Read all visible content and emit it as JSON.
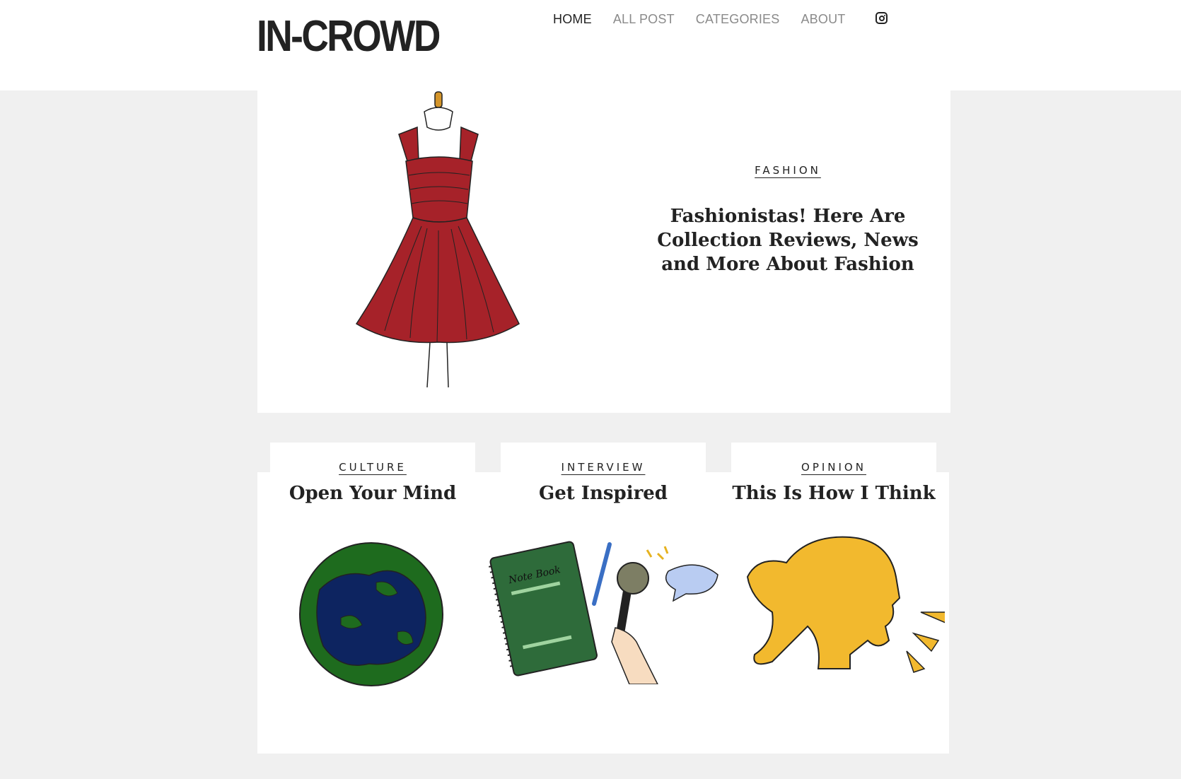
{
  "header": {
    "logo": "IN-CROWD",
    "nav": [
      {
        "label": "HOME",
        "active": true
      },
      {
        "label": "ALL POST",
        "active": false
      },
      {
        "label": "CATEGORIES",
        "active": false
      },
      {
        "label": "ABOUT",
        "active": false
      }
    ],
    "social_icon": "instagram-icon"
  },
  "hero": {
    "category": "FASHION",
    "title": "Fashionistas! Here Are Collection Reviews, News and More About Fashion",
    "image_icon": "red-dress-illustration"
  },
  "cards": [
    {
      "category": "CULTURE",
      "title": "Open Your Mind",
      "image_icon": "globe-illustration"
    },
    {
      "category": "INTERVIEW",
      "title": "Get Inspired",
      "image_icon": "notebook-microphone-illustration"
    },
    {
      "category": "OPINION",
      "title": "This Is How I Think",
      "image_icon": "speaking-head-illustration"
    }
  ],
  "colors": {
    "background": "#f0f0f0",
    "text": "#222222",
    "nav_inactive": "#8a8a8a",
    "dress": "#a62229",
    "globe_land": "#1e6b1e",
    "globe_water": "#0d2460",
    "notebook": "#2e6b3a",
    "hair": "#f2b92e"
  }
}
